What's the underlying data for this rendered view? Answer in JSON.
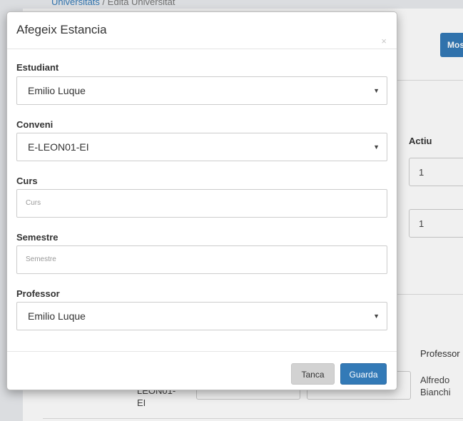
{
  "background": {
    "breadcrumb": {
      "link": "Universitats",
      "separator": "/",
      "current": "Edita Universitat"
    },
    "show_button_label": "Mos",
    "columns": {
      "actiu": "Actiu",
      "professor": "Professor"
    },
    "rows": [
      {
        "actiu": "1"
      },
      {
        "actiu": "1"
      }
    ],
    "bottom_row": {
      "conveni": "LEON01-\nEI",
      "professor": "Alfredo\nBianchi"
    }
  },
  "modal": {
    "title": "Afegeix Estancia",
    "close_symbol": "×",
    "fields": {
      "estudiant": {
        "label": "Estudiant",
        "value": "Emilio Luque"
      },
      "conveni": {
        "label": "Conveni",
        "value": "E-LEON01-EI"
      },
      "curs": {
        "label": "Curs",
        "placeholder": "Curs"
      },
      "semestre": {
        "label": "Semestre",
        "placeholder": "Semestre"
      },
      "professor": {
        "label": "Professor",
        "value": "Emilio Luque"
      }
    },
    "caret_symbol": "▼",
    "buttons": {
      "close": "Tanca",
      "save": "Guarda"
    }
  }
}
